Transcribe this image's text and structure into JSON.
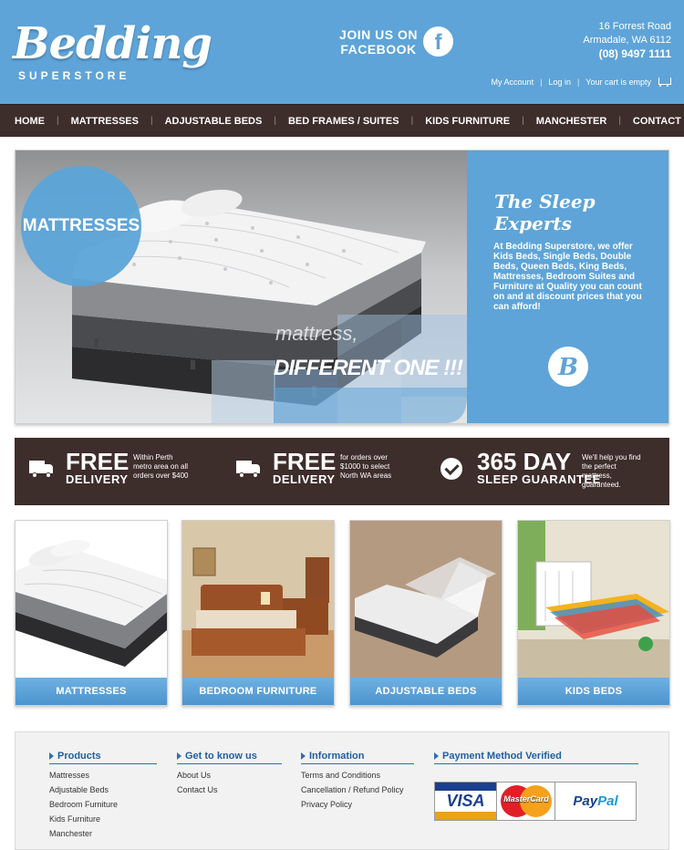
{
  "header": {
    "logo_main": "Bedding",
    "logo_sub": "SUPERSTORE",
    "facebook_line1": "JOIN US ON",
    "facebook_line2": "FACEBOOK",
    "facebook_icon": "f",
    "address1": "16 Forrest Road",
    "address2": "Armadale, WA 6112",
    "phone": "(08) 9497 1111",
    "my_account": "My Account",
    "log_in": "Log in",
    "cart": "Your cart is empty"
  },
  "nav": {
    "items": [
      "HOME",
      "MATTRESSES",
      "ADJUSTABLE BEDS",
      "BED FRAMES / SUITES",
      "KIDS FURNITURE",
      "MANCHESTER",
      "CONTACT US"
    ]
  },
  "hero": {
    "badge": "MATTRESSES",
    "overlay_line1": "mattress,",
    "overlay_line2": "DIFFERENT ONE !!!",
    "heading": "The Sleep Experts",
    "text": "At Bedding Superstore, we offer Kids Beds, Single Beds, Double Beds, Queen Beds, King Beds, Mattresses, Bedroom Suites and Furniture at Quality you can count on and at discount prices that you can afford!",
    "circle_letter": "B"
  },
  "features": [
    {
      "big": "FREE",
      "small": "DELIVERY",
      "note": "Within Perth metro area on all orders over $400",
      "icon": "truck-icon"
    },
    {
      "big": "FREE",
      "small": "DELIVERY",
      "note": "for orders over $1000 to select North WA areas",
      "icon": "truck-icon"
    },
    {
      "big": "365 DAY",
      "small": "SLEEP GUARANTEE",
      "note": "We'll help you find the perfect mattress, guaranteed.",
      "icon": "check-icon"
    }
  ],
  "categories": [
    {
      "label": "MATTRESSES"
    },
    {
      "label": "BEDROOM FURNITURE"
    },
    {
      "label": "ADJUSTABLE BEDS"
    },
    {
      "label": "KIDS BEDS"
    }
  ],
  "footer": {
    "products": {
      "title": "Products",
      "items": [
        "Mattresses",
        "Adjustable Beds",
        "Bedroom Furniture",
        "Kids Furniture",
        "Manchester"
      ]
    },
    "about": {
      "title": "Get to know us",
      "items": [
        "About Us",
        "Contact Us"
      ]
    },
    "info": {
      "title": "Information",
      "items": [
        "Terms and Conditions",
        "Cancellation / Refund Policy",
        "Privacy Policy"
      ]
    },
    "payment": {
      "title": "Payment Method Verified",
      "visa": "VISA",
      "mastercard": "MasterCard",
      "paypal_a": "Pay",
      "paypal_b": "Pal"
    }
  },
  "colors": {
    "brand_blue": "#5ea4d8",
    "dark_brown": "#3d2d2b",
    "link_blue": "#1f5fa0"
  }
}
